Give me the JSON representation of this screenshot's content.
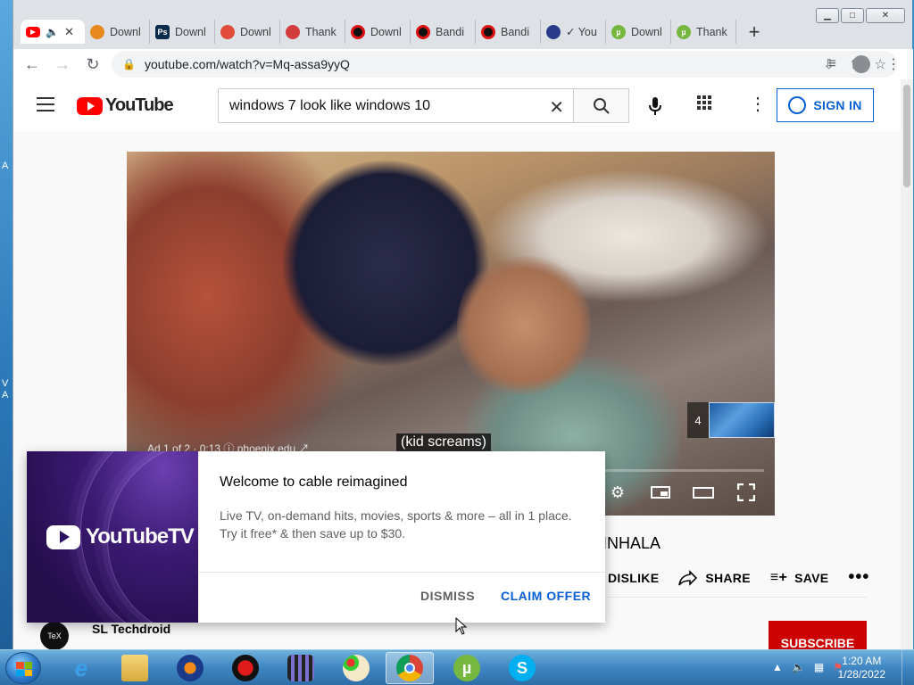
{
  "desktop": {
    "left_labels": [
      "A",
      "V",
      "A"
    ]
  },
  "browser": {
    "tabs": [
      {
        "title": "",
        "favicon": "youtube-icon",
        "active": true
      },
      {
        "title": "Downl",
        "favicon": "download-orange-icon"
      },
      {
        "title": "Downl",
        "favicon": "ps-icon"
      },
      {
        "title": "Downl",
        "favicon": "download-red-icon"
      },
      {
        "title": "Thank",
        "favicon": "thank-icon"
      },
      {
        "title": "Downl",
        "favicon": "bandicam-icon"
      },
      {
        "title": "Bandi",
        "favicon": "bandicam-icon"
      },
      {
        "title": "Bandi",
        "favicon": "bandicam-icon"
      },
      {
        "title": "✓ You",
        "favicon": "headphones-icon"
      },
      {
        "title": "Downl",
        "favicon": "utorrent-icon"
      },
      {
        "title": "Thank",
        "favicon": "utorrent-icon"
      }
    ],
    "url": "youtube.com/watch?v=Mq-assa9yyQ",
    "window_buttons": {
      "minimize": "▁",
      "maximize": "□",
      "close": "✕"
    }
  },
  "youtube": {
    "logo_text": "YouTube",
    "search_value": "windows 7 look like windows 10",
    "signin_label": "SIGN IN",
    "video": {
      "ad_info": "Ad 1 of 2 · 0:13  ⓘ  phoenix.edu ↗",
      "caption": "(kid screams)",
      "thumb_badge": "4",
      "progress_fraction": 0.07
    },
    "title_fragment": "INHALA",
    "actions": {
      "dislike": "DISLIKE",
      "share": "SHARE",
      "save": "SAVE",
      "more": "•••"
    },
    "channel": {
      "name": "SL Techdroid",
      "avatar_text": "TeX"
    },
    "subscribe_label": "SUBSCRIBE"
  },
  "promo": {
    "brand": "YouTubeTV",
    "title": "Welcome to cable reimagined",
    "text": "Live TV, on-demand hits, movies, sports & more – all in 1 place. Try it free* & then save up to $30.",
    "dismiss_label": "DISMISS",
    "claim_label": "CLAIM OFFER"
  },
  "taskbar": {
    "apps": [
      "internet-explorer-icon",
      "file-explorer-icon",
      "audacity-icon",
      "bandicam-icon",
      "movie-maker-icon",
      "paint-icon",
      "chrome-icon",
      "utorrent-icon",
      "skype-icon"
    ],
    "time": "1:20 AM",
    "date": "1/28/2022"
  }
}
